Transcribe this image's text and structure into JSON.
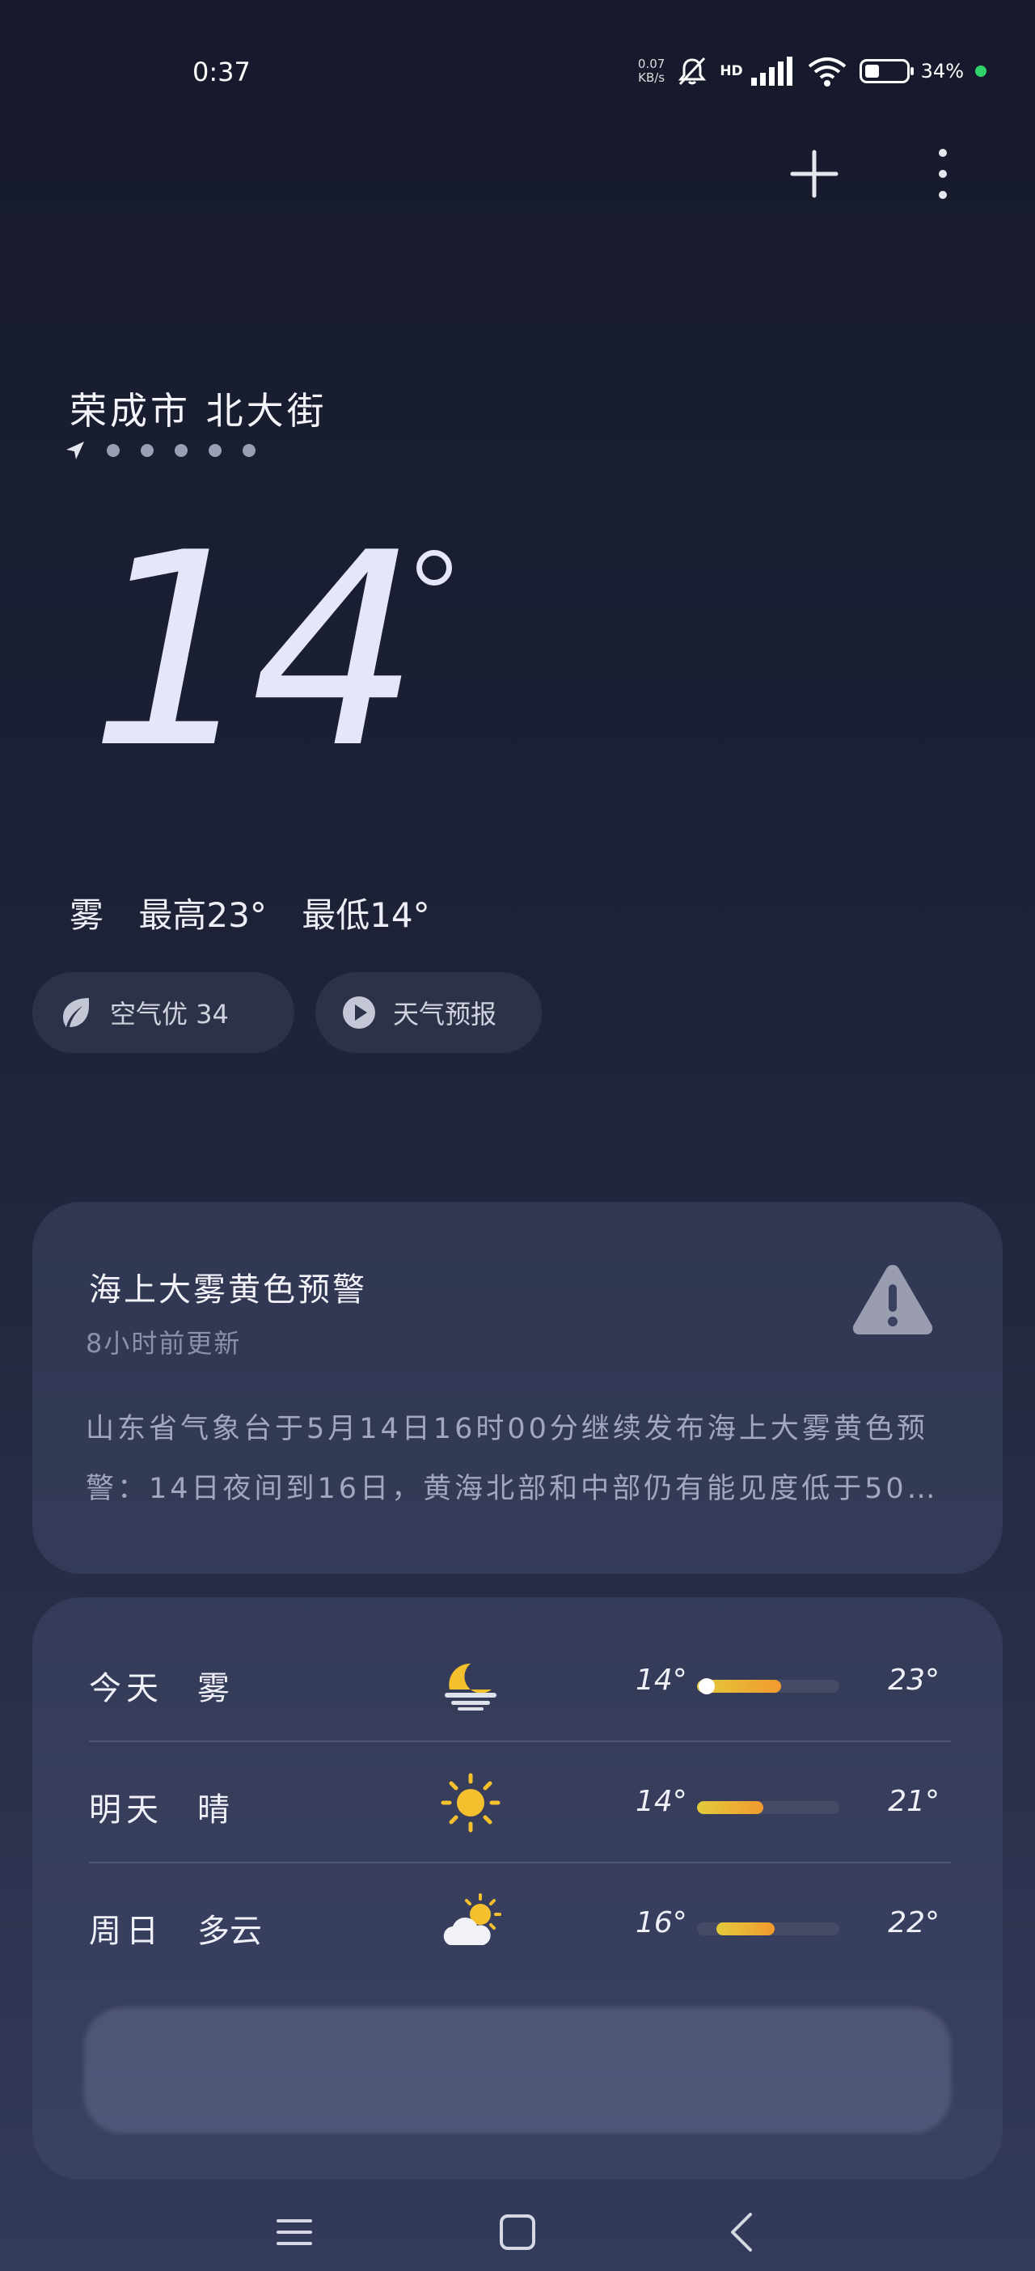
{
  "status_bar": {
    "time": "0:37",
    "net_speed_value": "0.07",
    "net_speed_unit": "KB/s",
    "network_label": "HD",
    "battery_percent": "34%",
    "battery_level": 0.34,
    "icons": [
      "bell-muted-icon",
      "signal-icon",
      "wifi-icon",
      "battery-icon"
    ]
  },
  "header": {
    "add_icon": "plus-icon",
    "more_icon": "more-vertical-icon"
  },
  "location": {
    "name": "荣成市 北大街",
    "page_count": 6,
    "current_page_icon": "location-arrow-icon"
  },
  "current": {
    "temperature": "14",
    "condition": "雾",
    "high": "最高23°",
    "low": "最低14°"
  },
  "pills": {
    "aqi": "空气优 34",
    "forecast_video": "天气预报"
  },
  "alert": {
    "title": "海上大雾黄色预警",
    "updated": "8小时前更新",
    "body": "山东省气象台于5月14日16时00分继续发布海上大雾黄色预警：14日夜间到16日，黄海北部和中部仍有能见度低于50…",
    "icon": "warning-icon"
  },
  "forecast": {
    "rows": [
      {
        "day": "今天",
        "condition": "雾",
        "icon": "fog-moon-icon",
        "low": "14°",
        "high": "23°"
      },
      {
        "day": "明天",
        "condition": "晴",
        "icon": "sun-icon",
        "low": "14°",
        "high": "21°"
      },
      {
        "day": "周日",
        "condition": "多云",
        "icon": "partly-cloudy-icon",
        "low": "16°",
        "high": "22°"
      }
    ],
    "more_button": ""
  },
  "colors": {
    "accent_sun": "#f5c02e",
    "bar_start": "#e3cb3c",
    "bar_end": "#f29a2e",
    "battery_dot": "#2fd36a"
  },
  "nav_bar": {
    "icons": [
      "menu-icon",
      "home-icon",
      "back-icon"
    ]
  }
}
